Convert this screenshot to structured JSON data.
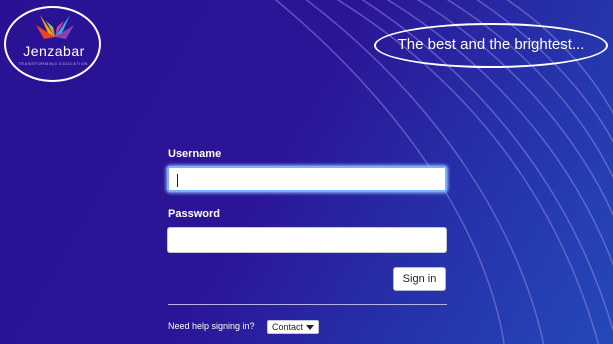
{
  "brand": {
    "name": "Jenzabar",
    "tagline_small": "TRANSFORMING EDUCATION",
    "logo_icon": "butterfly-icon"
  },
  "tagline": "The best and the brightest...",
  "form": {
    "username_label": "Username",
    "username_value": "",
    "password_label": "Password",
    "password_value": "",
    "signin_label": "Sign in"
  },
  "help": {
    "text": "Need help signing in?",
    "contact_label": "Contact"
  },
  "colors": {
    "background": "#2a1194",
    "background_accent": "#2449b9",
    "focus_ring": "#7fb0ff"
  }
}
